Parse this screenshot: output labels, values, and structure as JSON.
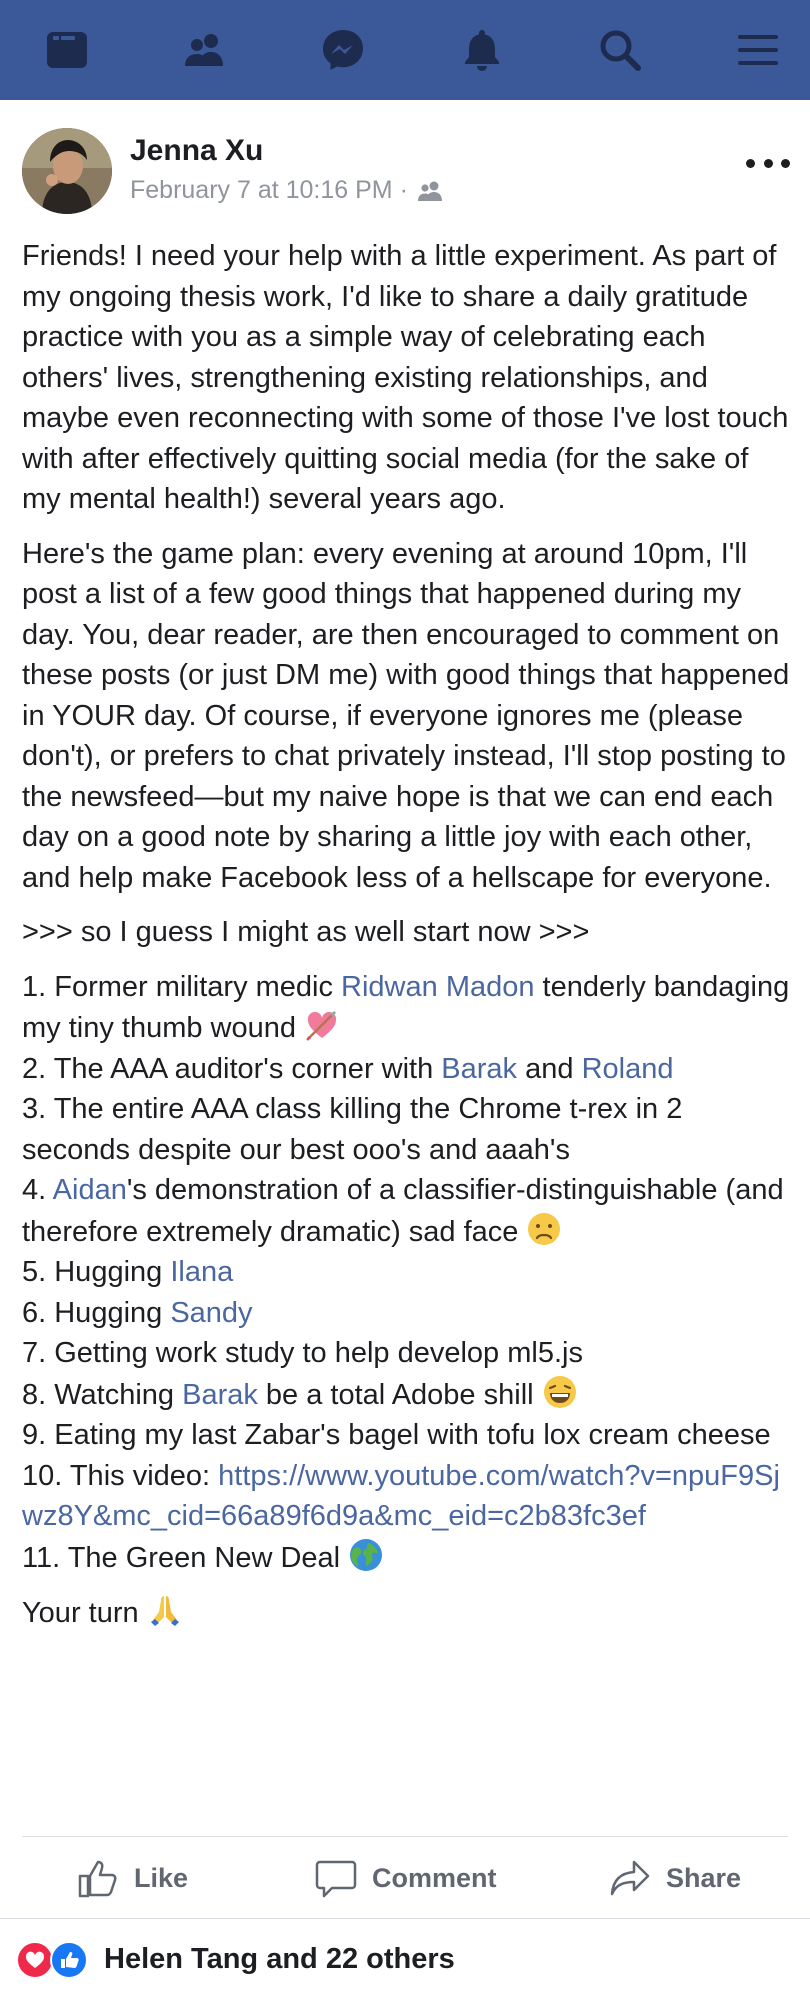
{
  "nav": {
    "items": [
      {
        "name": "news-feed-icon"
      },
      {
        "name": "friends-icon"
      },
      {
        "name": "messenger-icon"
      },
      {
        "name": "notifications-icon"
      },
      {
        "name": "search-icon"
      },
      {
        "name": "menu-icon"
      }
    ],
    "color": "#3b5998"
  },
  "post": {
    "author": "Jenna Xu",
    "timestamp": "February 7 at 10:16 PM ·",
    "audience_icon": "friends-audience-icon",
    "paragraph1": "Friends! I need your help with a little experiment. As part of my ongoing thesis work, I'd like to share a daily gratitude practice with you as a simple way of celebrating each others' lives, strengthening existing relationships, and maybe even reconnecting with some of those I've lost touch with after effectively quitting social media (for the sake of my mental health!) several years ago.",
    "paragraph2": "Here's the game plan: every evening at around 10pm, I'll post a list of a few good things that happened during my day. You, dear reader, are then encouraged to comment on these posts (or just DM me) with good things that happened in YOUR day. Of course, if everyone ignores me (please don't), or prefers to chat privately instead, I'll stop posting to the newsfeed—but my naive hope is that we can end each day on a good note by sharing a little joy with each other, and help make Facebook less of a hellscape for everyone.",
    "paragraph3": ">>> so I guess I might as well start now >>>",
    "list": {
      "i1_pre": "1. Former military medic ",
      "i1_mention": "Ridwan Madon",
      "i1_post": " tenderly bandaging my tiny thumb wound ",
      "i2_pre": "2. The AAA auditor's corner with ",
      "i2_mention_a": "Barak",
      "i2_mid": " and ",
      "i2_mention_b": "Roland",
      "i3": "3. The entire AAA class killing the Chrome t-rex in 2 seconds despite our best ooo's and aaah's",
      "i4_pre": "4. ",
      "i4_mention": "Aidan",
      "i4_post": "'s demonstration of a classifier-distinguishable (and therefore extremely dramatic) sad face ",
      "i5_pre": "5. Hugging ",
      "i5_mention": "Ilana",
      "i6_pre": "6. Hugging ",
      "i6_mention": "Sandy",
      "i7": "7. Getting work study to help develop ml5.js",
      "i8_pre": "8. Watching ",
      "i8_mention": "Barak",
      "i8_post": " be a total Adobe shill ",
      "i9": "9. Eating my last Zabar's bagel with tofu lox cream cheese",
      "i10_pre": "10. This video: ",
      "i10_link": "https://www.youtube.com/watch?v=npuF9Sjwz8Y&mc_cid=66a89f6d9a&mc_eid=c2b83fc3ef",
      "i11": "11. The Green New Deal "
    },
    "closing": "Your turn "
  },
  "actions": {
    "like": "Like",
    "comment": "Comment",
    "share": "Share"
  },
  "reactions": {
    "summary": "Helen Tang and 22 others"
  },
  "colors": {
    "link": "#4b67a1",
    "text": "#1c1e21",
    "meta": "#90949c"
  }
}
